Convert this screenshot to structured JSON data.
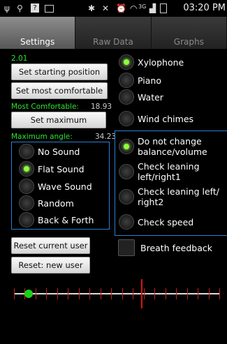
{
  "status_bar": {
    "icons": [
      "usb-icon",
      "location-icon",
      "question-icon",
      "image-icon",
      "bluetooth-icon",
      "mute-icon",
      "alarm-icon",
      "wifi-icon",
      "signal-icon",
      "battery-icon"
    ],
    "network": "3G",
    "time": "03:20 PM"
  },
  "tabs": [
    {
      "label": "Settings",
      "active": true
    },
    {
      "label": "Raw Data",
      "active": false
    },
    {
      "label": "Graphs",
      "active": false
    }
  ],
  "left": {
    "version": "2.01",
    "set_start_label": "Set starting position",
    "set_comfortable_label": "Set most comfortable",
    "most_comfortable_label": "Most Comfortable:",
    "most_comfortable_value": "18.93",
    "set_maximum_label": "Set maximum",
    "maximum_angle_label": "Maximum angle:",
    "maximum_angle_value": "34.23",
    "sound_options": [
      {
        "label": "No Sound",
        "selected": false
      },
      {
        "label": "Flat Sound",
        "selected": true
      },
      {
        "label": "Wave Sound",
        "selected": false
      },
      {
        "label": "Random",
        "selected": false
      },
      {
        "label": "Back & Forth",
        "selected": false
      }
    ],
    "reset_current_label": "Reset current user",
    "reset_new_label": "Reset: new user"
  },
  "right": {
    "instruments": [
      {
        "label": "Xylophone",
        "selected": true
      },
      {
        "label": "Piano",
        "selected": false
      },
      {
        "label": "Water",
        "selected": false
      },
      {
        "label": "Wind chimes",
        "selected": false
      }
    ],
    "modes": [
      {
        "label": "Do not change balance/volume",
        "selected": true
      },
      {
        "label": "Check leaning left/right1",
        "selected": false
      },
      {
        "label": "Check leaning left/ right2",
        "selected": false
      },
      {
        "label": "Check speed",
        "selected": false
      }
    ],
    "breath_feedback_label": "Breath feedback",
    "breath_feedback_checked": false
  },
  "slider": {
    "position": 0.07,
    "marker": 0.62
  }
}
